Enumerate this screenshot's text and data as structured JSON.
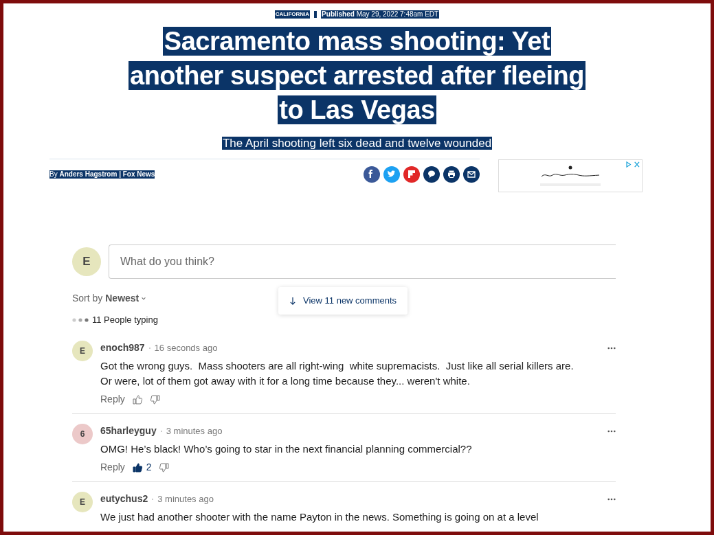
{
  "article": {
    "category": "CALIFORNIA",
    "published_label": "Published",
    "published_date": "May 29, 2022 7:48am EDT",
    "headline": "Sacramento mass shooting: Yet another suspect arrested after fleeing to Las Vegas",
    "subheadline": "The April shooting left six dead and twelve wounded",
    "byline_prefix": "By",
    "byline": "Anders Hagstrom | Fox News"
  },
  "comments_section": {
    "user_initial": "E",
    "placeholder": "What do you think?",
    "sort_label": "Sort by",
    "sort_value": "Newest",
    "new_comments": "View 11 new comments",
    "typing": "11 People typing",
    "comments": [
      {
        "initial": "E",
        "color": "#e6e6bd",
        "author": "enoch987",
        "time": "16 seconds ago",
        "text": "Got the wrong guys.  Mass shooters are all right-wing  white supremacists.  Just like all serial killers are.  Or were, lot of them got away with it for a long time because they... weren't white.",
        "reply": "Reply",
        "liked": false
      },
      {
        "initial": "6",
        "color": "#ecc9c9",
        "author": "65harleyguy",
        "time": "3 minutes ago",
        "text": "OMG! He’s black! Who’s going to star in the next financial planning commercial??",
        "reply": "Reply",
        "liked": true,
        "likes": "2"
      },
      {
        "initial": "E",
        "color": "#e6e6bd",
        "author": "eutychus2",
        "time": "3 minutes ago",
        "text": "We just had another shooter with the name Payton in the news. Something is going on at a level"
      }
    ]
  }
}
